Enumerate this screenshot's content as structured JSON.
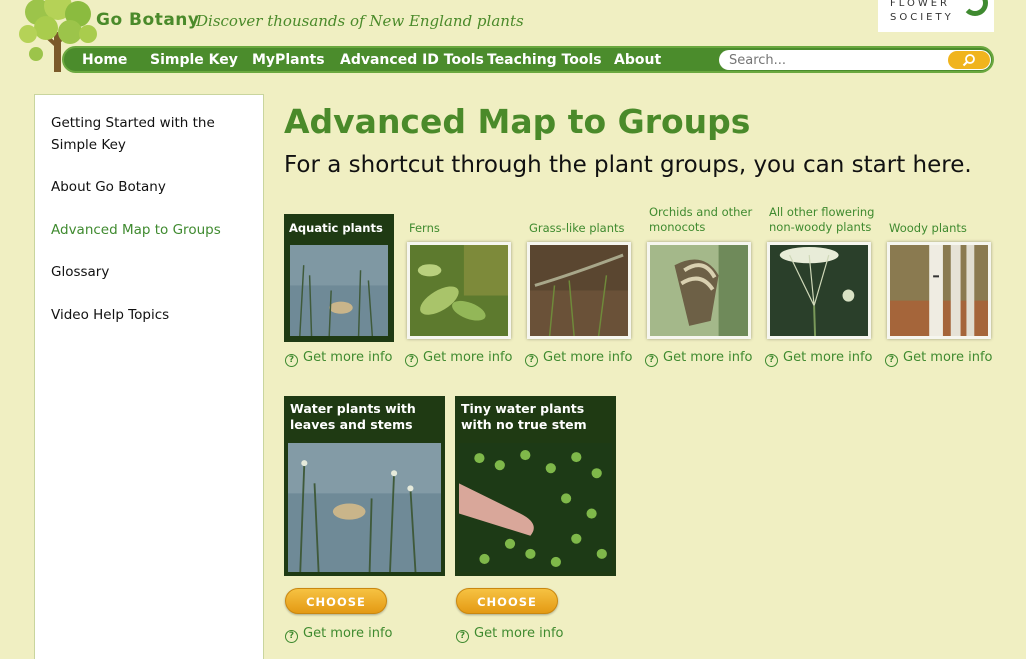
{
  "header": {
    "brand": "Go Botany",
    "tagline": "Discover thousands of New England plants",
    "society_line1": "FLOWER",
    "society_line2": "SOCIETY"
  },
  "nav": {
    "items": [
      "Home",
      "Simple Key",
      "MyPlants",
      "Advanced ID Tools",
      "Teaching Tools",
      "About"
    ],
    "search_placeholder": "Search..."
  },
  "sidebar": {
    "items": [
      {
        "label": "Getting Started with the Simple Key",
        "active": false
      },
      {
        "label": "About Go Botany",
        "active": false
      },
      {
        "label": "Advanced Map to Groups",
        "active": true
      },
      {
        "label": "Glossary",
        "active": false
      },
      {
        "label": "Video Help Topics",
        "active": false
      }
    ]
  },
  "main": {
    "title": "Advanced Map to Groups",
    "subtitle": "For a shortcut through the plant groups, you can start here.",
    "more_info": "Get more info",
    "groups": [
      {
        "label": "Aquatic plants",
        "selected": true,
        "icon": "aquatic-photo"
      },
      {
        "label": "Ferns",
        "selected": false,
        "icon": "ferns-photo"
      },
      {
        "label": "Grass-like plants",
        "selected": false,
        "icon": "grass-photo"
      },
      {
        "label": "Orchids and other monocots",
        "selected": false,
        "icon": "orchid-photo"
      },
      {
        "label": "All other flowering non-woody plants",
        "selected": false,
        "icon": "flowering-photo"
      },
      {
        "label": "Woody plants",
        "selected": false,
        "icon": "woody-photo"
      }
    ],
    "subgroups": [
      {
        "label": "Water plants with leaves and stems",
        "button": "CHOOSE",
        "icon": "water-plants-photo"
      },
      {
        "label": "Tiny water plants with no true stem",
        "button": "CHOOSE",
        "icon": "duckweed-photo"
      }
    ]
  },
  "colors": {
    "background": "#f0efc2",
    "nav": "#4b8c2c",
    "accent": "#3f8a2f",
    "selected_card": "#1f3a13",
    "button": "#f0b41d"
  }
}
